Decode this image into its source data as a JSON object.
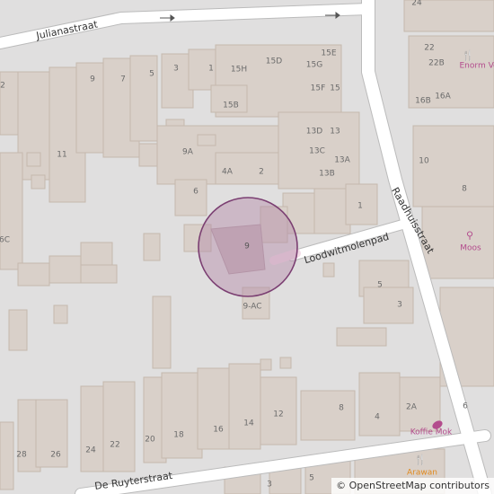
{
  "streets": {
    "julianastraat": "Julianastraat",
    "raadhuisstraat": "Raadhuisstraat",
    "loodwitmolenpad": "Loodwitmolenpad",
    "de_ruyterstraat": "De Ruyterstraat"
  },
  "house_numbers": [
    "24",
    "22",
    "22B",
    "16A",
    "16B",
    "10",
    "8",
    "6",
    "4",
    "3",
    "2",
    "2A",
    "1",
    "5",
    "7",
    "9",
    "11",
    "12",
    "13",
    "13A",
    "13B",
    "13C",
    "13D",
    "14",
    "15",
    "15D",
    "15E",
    "15F",
    "15G",
    "15H",
    "15B",
    "16",
    "18",
    "20",
    "26",
    "28",
    "3",
    "5",
    "9A",
    "4A",
    "9-AC",
    "6C",
    "2"
  ],
  "pois": {
    "enorm_label": "Enorm Veens",
    "moos_label": "Moos",
    "koffie_label": "Koffie Mok",
    "arawan_label": "Arawan"
  },
  "marker": {
    "number": "9"
  },
  "attribution": {
    "symbol": "©",
    "text": "OpenStreetMap contributors"
  },
  "colors": {
    "background": "#e0dfdf",
    "building": "#d9d0c9",
    "building_stroke": "#c5b8ad",
    "road": "#ffffff",
    "road_casing": "#bbbbbb",
    "marker_fill": "#b48aa8",
    "marker_stroke": "#7b3f72",
    "poi_pink": "#b34c8d",
    "poi_orange": "#e08a1e"
  }
}
